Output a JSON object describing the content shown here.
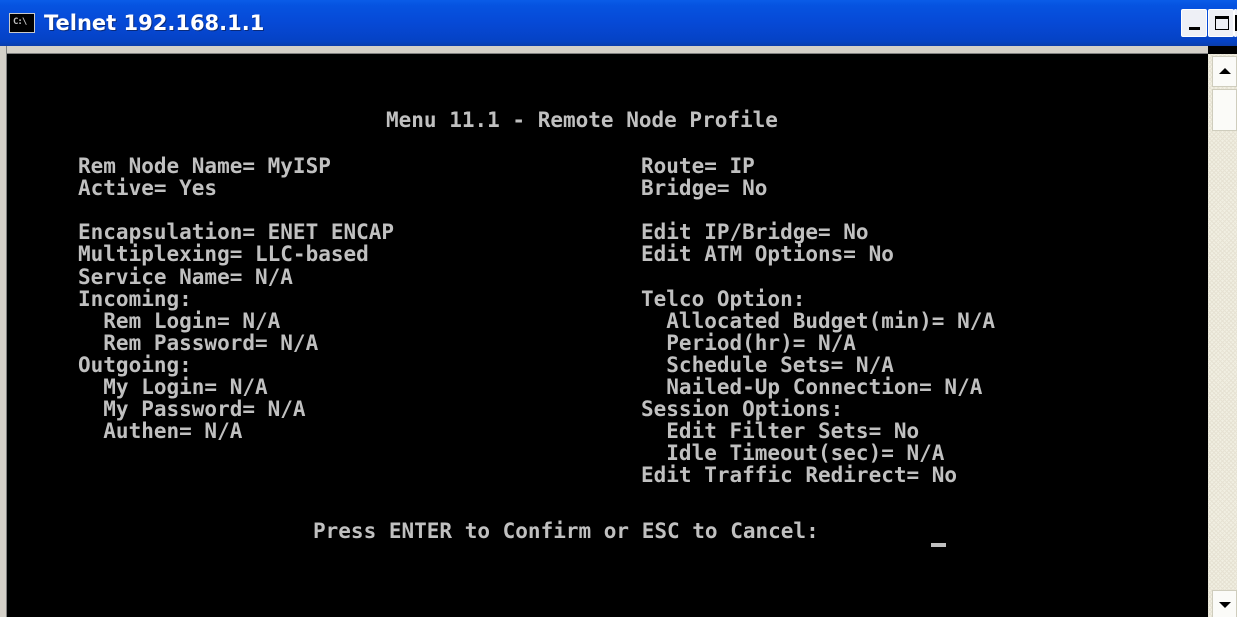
{
  "window": {
    "title": "Telnet 192.168.1.1",
    "icon_text": "C:\\"
  },
  "menu": {
    "heading": "Menu 11.1 - Remote Node Profile",
    "left": [
      "Rem Node Name= MyISP",
      "Active= Yes",
      "",
      "Encapsulation= ENET ENCAP",
      "Multiplexing= LLC-based",
      "Service Name= N/A",
      "Incoming:",
      "  Rem Login= N/A",
      "  Rem Password= N/A",
      "Outgoing:",
      "  My Login= N/A",
      "  My Password= N/A",
      "  Authen= N/A"
    ],
    "right": [
      "Route= IP",
      "Bridge= No",
      "",
      "Edit IP/Bridge= No",
      "Edit ATM Options= No",
      "",
      "Telco Option:",
      "  Allocated Budget(min)= N/A",
      "  Period(hr)= N/A",
      "  Schedule Sets= N/A",
      "  Nailed-Up Connection= N/A",
      "Session Options:",
      "  Edit Filter Sets= No",
      "  Idle Timeout(sec)= N/A",
      "Edit Traffic Redirect= No"
    ],
    "prompt": "Press ENTER to Confirm or ESC to Cancel:"
  }
}
